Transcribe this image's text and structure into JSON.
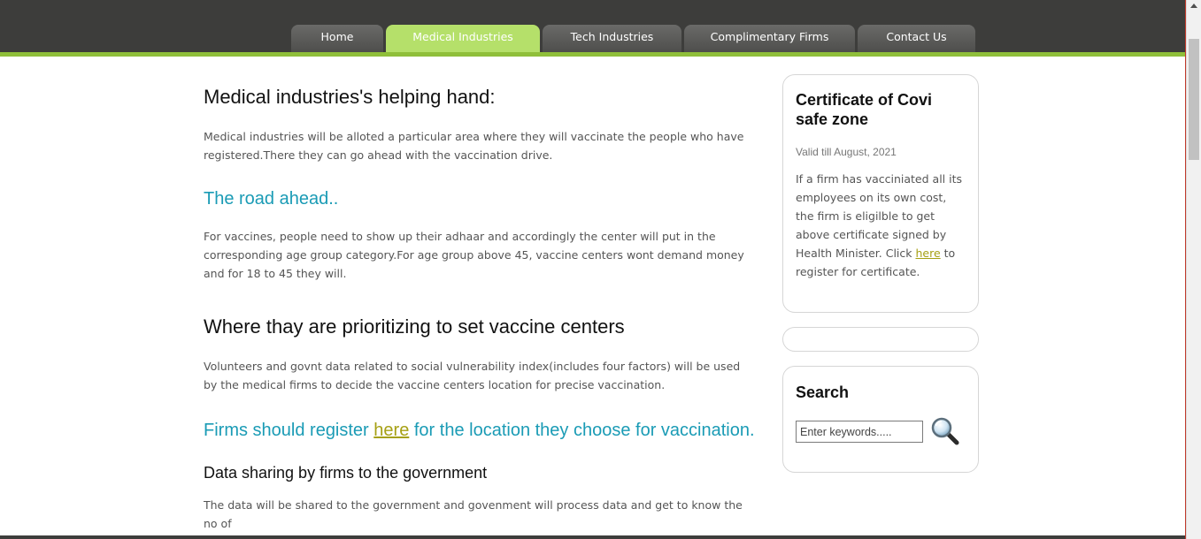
{
  "nav": {
    "items": [
      {
        "label": "Home"
      },
      {
        "label": "Medical Industries",
        "active": true
      },
      {
        "label": "Tech Industries"
      },
      {
        "label": "Complimentary Firms"
      },
      {
        "label": "Contact Us"
      }
    ]
  },
  "colors": {
    "header_bg": "#3d3d3b",
    "accent_green": "#8fbf3a",
    "active_tab": "#b5e06a",
    "heading_teal": "#1a9bb5",
    "link": "#a6a014"
  },
  "main": {
    "section1": {
      "heading": "Medical industries's helping hand:",
      "text": "Medical industries will be alloted a particular area where they will vaccinate the people who have registered.There they can go ahead with the vaccination drive."
    },
    "section2": {
      "heading": "The road ahead..",
      "text": "For vaccines, people need to show up their adhaar and accordingly the center will put in the corresponding age group category.For age group above 45, vaccine centers wont demand money and for 18 to 45 they will."
    },
    "section3": {
      "heading": "Where thay are prioritizing to set vaccine centers",
      "text": "Volunteers and govnt data related to social vulnerability index(includes four factors) will be used by the medical firms to decide the vaccine centers location for precise vaccination."
    },
    "section4": {
      "heading_before": "Firms should register ",
      "heading_link": "here",
      "heading_after": " for the location they choose for vaccination."
    },
    "section5": {
      "heading": "Data sharing by firms to the government",
      "text": "The data will be shared to the government and govenment will process data and get to know the no of"
    }
  },
  "sidebar": {
    "certificate": {
      "title": "Certificate of Covi safe zone",
      "validity": "Valid till August, 2021",
      "text_before": "If a firm has vacciniated all its employees on its own cost, the firm is eligilble to get above certificate signed by Health Minister. Click ",
      "link": "here",
      "text_after": " to register for certificate."
    },
    "search": {
      "title": "Search",
      "placeholder": "Enter keywords.....",
      "button_icon": "magnifier-icon"
    }
  }
}
